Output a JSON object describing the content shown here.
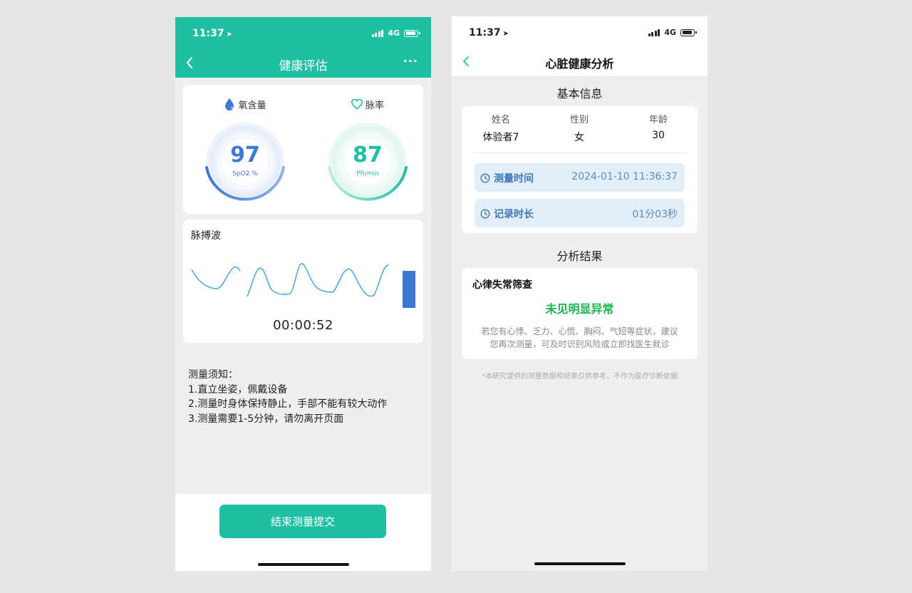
{
  "left_screen": {
    "status": {
      "time": "11:37",
      "network": "4G"
    },
    "header": {
      "title": "健康评估"
    },
    "vitals": {
      "spo2": {
        "label": "氧含量",
        "value": "97",
        "unit": "SpO2 %"
      },
      "pulse": {
        "label": "脉率",
        "value": "87",
        "unit": "PR/min"
      }
    },
    "waveform": {
      "title": "脉搏波",
      "timer": "00:00:52"
    },
    "notes": {
      "title": "测量须知：",
      "items": [
        "1.直立坐姿，佩戴设备",
        "2.测量时身体保持静止，手部不能有较大动作",
        "3.测量需要1-5分钟，请勿离开页面"
      ]
    },
    "submit_label": "结束测量提交"
  },
  "right_screen": {
    "status": {
      "time": "11:37",
      "network": "4G"
    },
    "header": {
      "title": "心脏健康分析"
    },
    "basic_info": {
      "title": "基本信息",
      "name": {
        "label": "姓名",
        "value": "体验者7"
      },
      "gender": {
        "label": "性别",
        "value": "女"
      },
      "age": {
        "label": "年龄",
        "value": "30"
      },
      "measure_time": {
        "label": "测量时间",
        "value": "2024-01-10 11:36:37"
      },
      "duration": {
        "label": "记录时长",
        "value": "01分03秒"
      }
    },
    "analysis": {
      "title": "分析结果",
      "item_title": "心律失常筛查",
      "status": "未见明显异常",
      "advice_line1": "若您有心悸、乏力、心慌、胸闷、气短等症状，建议",
      "advice_line2": "您再次测量，可及时识别风险或立即找医生就诊"
    },
    "disclaimer": "*本研究提供的测量数据和结果仅供参考，不作为医疗诊断依据"
  },
  "colors": {
    "teal": "#1fbfa4",
    "spo2_blue": "#3b78d8",
    "success_green": "#1bb24f",
    "wave": "#3aa3e0"
  }
}
